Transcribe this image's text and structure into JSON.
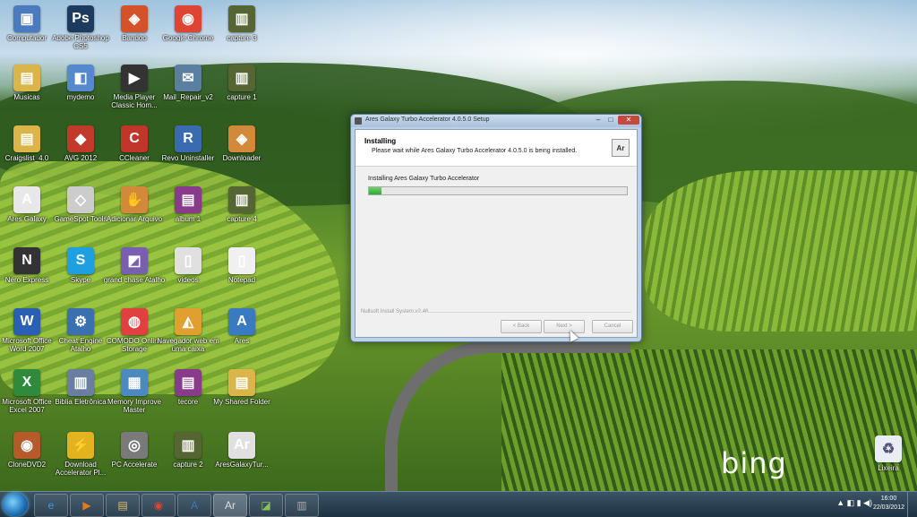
{
  "desktop": {
    "wallpaper_logo": "bing",
    "icons_col1": [
      {
        "label": "Computador",
        "icon": "computer-icon",
        "color": "#4a7bbf",
        "glyph": "▣"
      },
      {
        "label": "Musicas",
        "icon": "folder-icon",
        "color": "#d9b54a",
        "glyph": "▤"
      },
      {
        "label": "Craigslist_4.0",
        "icon": "folder-icon",
        "color": "#d9b54a",
        "glyph": "▤"
      },
      {
        "label": "Ares Galaxy",
        "icon": "ares-icon",
        "color": "#e8e8e8",
        "glyph": "A"
      },
      {
        "label": "Nero Express",
        "icon": "nero-icon",
        "color": "#333333",
        "glyph": "N"
      },
      {
        "label": "Microsoft Office Word 2007",
        "icon": "word-icon",
        "color": "#2b5fb3",
        "glyph": "W"
      },
      {
        "label": "Microsoft Office Excel 2007",
        "icon": "excel-icon",
        "color": "#2f8a3b",
        "glyph": "X"
      },
      {
        "label": "CloneDVD2",
        "icon": "clonedvd-icon",
        "color": "#b55a2a",
        "glyph": "◉"
      }
    ],
    "icons_col2": [
      {
        "label": "Adobe Photoshop CS5",
        "icon": "photoshop-icon",
        "color": "#1d3b5e",
        "glyph": "Ps"
      },
      {
        "label": "mydemo",
        "icon": "app-icon",
        "color": "#5588cc",
        "glyph": "◧"
      },
      {
        "label": "AVG 2012",
        "icon": "avg-icon",
        "color": "#c23a2a",
        "glyph": "◆"
      },
      {
        "label": "GameSpot Tools",
        "icon": "app-icon",
        "color": "#cccccc",
        "glyph": "◇"
      },
      {
        "label": "Skype",
        "icon": "skype-icon",
        "color": "#1ea0e0",
        "glyph": "S"
      },
      {
        "label": "Cheat Engine Atalho",
        "icon": "cheat-engine-icon",
        "color": "#3a6fb0",
        "glyph": "⚙"
      },
      {
        "label": "Biblia Eletrônica",
        "icon": "book-icon",
        "color": "#6a7fa0",
        "glyph": "▥"
      },
      {
        "label": "Download Accelerator Pl...",
        "icon": "dap-icon",
        "color": "#e2b21f",
        "glyph": "⚡"
      }
    ],
    "icons_col3": [
      {
        "label": "Bandoo",
        "icon": "fox-icon",
        "color": "#d4522a",
        "glyph": "◈"
      },
      {
        "label": "Media Player Classic Hom...",
        "icon": "media-player-icon",
        "color": "#333333",
        "glyph": "▶"
      },
      {
        "label": "CCleaner",
        "icon": "ccleaner-icon",
        "color": "#c2352a",
        "glyph": "C"
      },
      {
        "label": "Adicionar Arquivo",
        "icon": "app-icon",
        "color": "#d28a3a",
        "glyph": "✋"
      },
      {
        "label": "grand chase Atalho",
        "icon": "game-icon",
        "color": "#7a5fb0",
        "glyph": "◩"
      },
      {
        "label": "COMODO Online Storage",
        "icon": "comodo-icon",
        "color": "#e04040",
        "glyph": "◍"
      },
      {
        "label": "Memory Improve Master",
        "icon": "memory-icon",
        "color": "#4a8ac0",
        "glyph": "▦"
      },
      {
        "label": "PC Accelerate",
        "icon": "pc-accelerate-icon",
        "color": "#7a7a7a",
        "glyph": "◎"
      }
    ],
    "icons_col4": [
      {
        "label": "Google Chrome",
        "icon": "chrome-icon",
        "color": "#dd4433",
        "glyph": "◉"
      },
      {
        "label": "Mail_Repair_v2",
        "icon": "app-icon",
        "color": "#5a7fa0",
        "glyph": "✉"
      },
      {
        "label": "Revo Uninstaller",
        "icon": "revo-icon",
        "color": "#3a6ab0",
        "glyph": "R"
      },
      {
        "label": "album 1",
        "icon": "winrar-icon",
        "color": "#8a3a8a",
        "glyph": "▤"
      },
      {
        "label": "videos",
        "icon": "document-icon",
        "color": "#e0e0e0",
        "glyph": "▯"
      },
      {
        "label": "Navegador web em uma caixa",
        "icon": "pizza-icon",
        "color": "#e0a030",
        "glyph": "◭"
      },
      {
        "label": "tecore",
        "icon": "winrar-icon",
        "color": "#8a3a8a",
        "glyph": "▤"
      },
      {
        "label": "capture 2",
        "icon": "video-icon",
        "color": "#556633",
        "glyph": "▥"
      }
    ],
    "icons_col5": [
      {
        "label": "capture 3",
        "icon": "video-icon",
        "color": "#556633",
        "glyph": "▥"
      },
      {
        "label": "capture 1",
        "icon": "video-icon",
        "color": "#556633",
        "glyph": "▥"
      },
      {
        "label": "Downloader",
        "icon": "app-icon",
        "color": "#d28a3a",
        "glyph": "◈"
      },
      {
        "label": "capture 4",
        "icon": "video-icon",
        "color": "#556633",
        "glyph": "▥"
      },
      {
        "label": "Notepad",
        "icon": "document-icon",
        "color": "#f0f0f0",
        "glyph": "▯"
      },
      {
        "label": "Ares",
        "icon": "ares-icon",
        "color": "#3a7ac0",
        "glyph": "A"
      },
      {
        "label": "My Shared Folder",
        "icon": "folder-icon",
        "color": "#d9b54a",
        "glyph": "▤"
      },
      {
        "label": "AresGalaxyTur...",
        "icon": "ares-setup-icon",
        "color": "#e0e0e0",
        "glyph": "Ar"
      }
    ],
    "recycle_bin": {
      "label": "Lixeira",
      "icon": "recycle-bin-icon"
    }
  },
  "dialog": {
    "title": "Ares Galaxy Turbo Accelerator 4.0.5.0 Setup",
    "header_title": "Installing",
    "header_subtitle": "Please wait while Ares Galaxy Turbo Accelerator 4.0.5.0 is being installed.",
    "logo_text": "Ar",
    "status_text": "Installing Ares Galaxy Turbo Accelerator",
    "progress": 0.05,
    "brand": "Nullsoft Install System v2.46",
    "back_label": "< Back",
    "next_label": "Next >",
    "cancel_label": "Cancel",
    "close_glyph": "✕",
    "min_glyph": "–",
    "max_glyph": "□"
  },
  "taskbar": {
    "items": [
      {
        "name": "ie-icon",
        "glyph": "e",
        "color": "#3a9ae0"
      },
      {
        "name": "media-player-icon",
        "glyph": "▶",
        "color": "#e07a20"
      },
      {
        "name": "explorer-icon",
        "glyph": "▤",
        "color": "#e0c060"
      },
      {
        "name": "chrome-icon",
        "glyph": "◉",
        "color": "#dd4433"
      },
      {
        "name": "ares-icon",
        "glyph": "A",
        "color": "#3a7ac0"
      },
      {
        "name": "ares-setup-icon",
        "glyph": "Ar",
        "color": "#dddddd",
        "active": true
      },
      {
        "name": "camtasia-icon",
        "glyph": "◪",
        "color": "#8ac060"
      },
      {
        "name": "video-icon",
        "glyph": "▥",
        "color": "#aaaaaa"
      }
    ],
    "tray_icons": "▲ ◧ ▮ ◀)",
    "time": "16:00",
    "date": "22/03/2012"
  }
}
